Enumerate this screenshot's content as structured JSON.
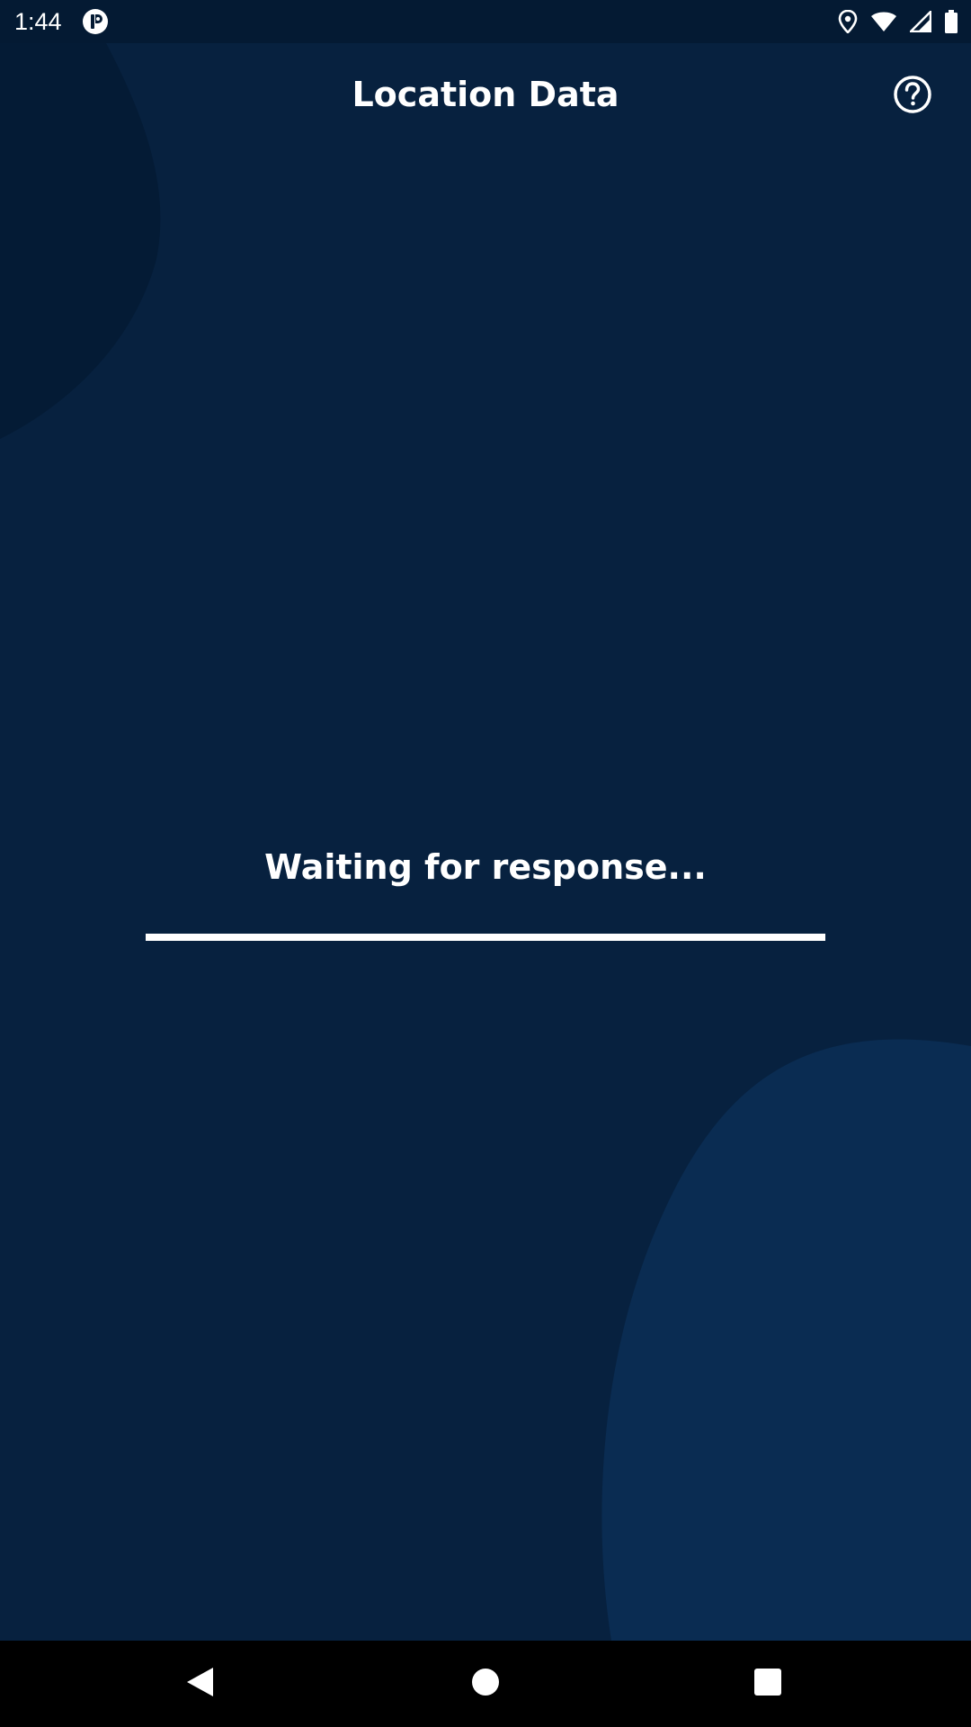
{
  "status_bar": {
    "time": "1:44",
    "icons": [
      "app-notification-icon",
      "location-icon",
      "wifi-icon",
      "signal-icon",
      "battery-icon"
    ]
  },
  "header": {
    "title": "Location Data",
    "help_icon": "help-circle-icon"
  },
  "main": {
    "status_text": "Waiting for response...",
    "progress_fraction": 1.0
  },
  "nav_bar": {
    "buttons": [
      "back-icon",
      "home-icon",
      "recents-icon"
    ]
  },
  "colors": {
    "background": "#07213f",
    "status_bar": "#041a33",
    "blob_dark": "#041b35",
    "blob_light": "#0a2c52",
    "text": "#ffffff",
    "nav_bar": "#000000"
  }
}
